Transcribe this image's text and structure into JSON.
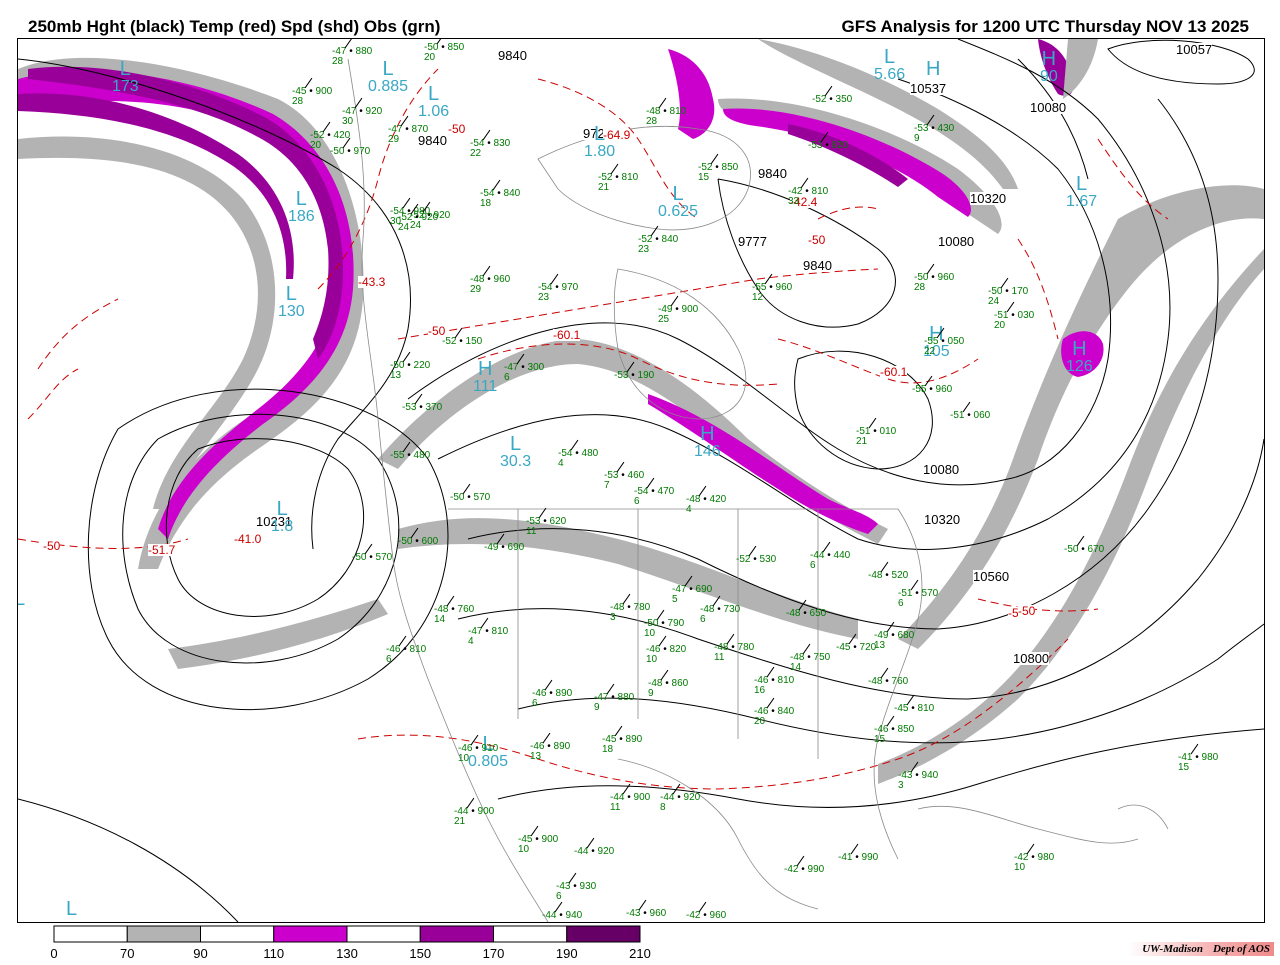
{
  "header": {
    "title_left": "250mb Hght (black) Temp (red) Spd (shd) Obs (grn)",
    "title_right": "GFS Analysis for 1200 UTC Thursday  NOV 13 2025"
  },
  "colors": {
    "height_contour": "#000000",
    "temperature_contour": "#cc0000",
    "obs_text": "#007a00",
    "center_label": "#3aa8c4",
    "coastline": "#8a8a8a"
  },
  "speed_legend": {
    "ticks": [
      "0",
      "70",
      "90",
      "110",
      "130",
      "150",
      "170",
      "190",
      "210"
    ],
    "bins": [
      {
        "from": "0",
        "to": "70",
        "color": "#ffffff"
      },
      {
        "from": "70",
        "to": "90",
        "color": "#b3b3b3"
      },
      {
        "from": "90",
        "to": "110",
        "color": "#ffffff"
      },
      {
        "from": "110",
        "to": "130",
        "color": "#cc00cc"
      },
      {
        "from": "130",
        "to": "150",
        "color": "#ffffff"
      },
      {
        "from": "150",
        "to": "170",
        "color": "#990099"
      },
      {
        "from": "170",
        "to": "190",
        "color": "#ffffff"
      },
      {
        "from": "190",
        "to": "210",
        "color": "#660066"
      }
    ]
  },
  "height_labels": [
    "9840",
    "9840",
    "9840",
    "9840",
    "9728",
    "9777",
    "10057",
    "10537",
    "10080",
    "10080",
    "10080",
    "10320",
    "10320",
    "10560",
    "10800",
    "10231"
  ],
  "temperature_labels": [
    "-50",
    "-50",
    "-50",
    "-50",
    "-50",
    "-50",
    "-41.0",
    "-51.7",
    "-43.3",
    "-60.1",
    "-60.1",
    "-64.9",
    "-42.4"
  ],
  "pressure_centers": [
    {
      "type": "L",
      "value": "173"
    },
    {
      "type": "L",
      "value": "0.885"
    },
    {
      "type": "L",
      "value": "1.06"
    },
    {
      "type": "L",
      "value": "1.80"
    },
    {
      "type": "L",
      "value": "0.625"
    },
    {
      "type": "L",
      "value": "5.66"
    },
    {
      "type": "H",
      "value": ""
    },
    {
      "type": "L",
      "value": "1.67"
    },
    {
      "type": "H",
      "value": "90"
    },
    {
      "type": "L",
      "value": "186"
    },
    {
      "type": "L",
      "value": "130"
    },
    {
      "type": "H",
      "value": "111"
    },
    {
      "type": "L",
      "value": "30.3"
    },
    {
      "type": "H",
      "value": "105"
    },
    {
      "type": "H",
      "value": "126"
    },
    {
      "type": "L",
      "value": "1.8"
    },
    {
      "type": "H",
      "value": "146"
    },
    {
      "type": "L",
      "value": "0.805"
    },
    {
      "type": "L",
      "value": ""
    },
    {
      "type": "L",
      "value": ""
    }
  ],
  "observations": [
    {
      "t": "-47",
      "h": "880",
      "d": "28"
    },
    {
      "t": "-50",
      "h": "850",
      "d": "20"
    },
    {
      "t": "-45",
      "h": "900",
      "d": "28"
    },
    {
      "t": "-47",
      "h": "920",
      "d": "30"
    },
    {
      "t": "-47",
      "h": "870",
      "d": "29"
    },
    {
      "t": "-54",
      "h": "830",
      "d": "22"
    },
    {
      "t": "-54",
      "h": "840",
      "d": "18"
    },
    {
      "t": "-54",
      "h": "980",
      "d": "30"
    },
    {
      "t": "-52",
      "h": "920",
      "d": "24"
    },
    {
      "t": "-52",
      "h": "810",
      "d": "21"
    },
    {
      "t": "-52",
      "h": "840",
      "d": "23"
    },
    {
      "t": "-48",
      "h": "960",
      "d": "29"
    },
    {
      "t": "-54",
      "h": "970",
      "d": "23"
    },
    {
      "t": "-49",
      "h": "900",
      "d": "25"
    },
    {
      "t": "-55",
      "h": "960",
      "d": "12"
    },
    {
      "t": "-50",
      "h": "960",
      "d": "28"
    },
    {
      "t": "-52",
      "h": "150",
      "d": ""
    },
    {
      "t": "-47",
      "h": "300",
      "d": "6"
    },
    {
      "t": "-50",
      "h": "220",
      "d": "13"
    },
    {
      "t": "-53",
      "h": "190",
      "d": ""
    },
    {
      "t": "-51",
      "h": "030",
      "d": "20"
    },
    {
      "t": "-55",
      "h": "050",
      "d": "22"
    },
    {
      "t": "-53",
      "h": "370",
      "d": ""
    },
    {
      "t": "-55",
      "h": "960",
      "d": ""
    },
    {
      "t": "-51",
      "h": "060",
      "d": ""
    },
    {
      "t": "-51",
      "h": "010",
      "d": "21"
    },
    {
      "t": "-55",
      "h": "480",
      "d": ""
    },
    {
      "t": "-54",
      "h": "480",
      "d": "4"
    },
    {
      "t": "-53",
      "h": "460",
      "d": "7"
    },
    {
      "t": "-54",
      "h": "470",
      "d": "6"
    },
    {
      "t": "-50",
      "h": "570",
      "d": ""
    },
    {
      "t": "-48",
      "h": "420",
      "d": "4"
    },
    {
      "t": "-53",
      "h": "620",
      "d": "11"
    },
    {
      "t": "-50",
      "h": "600",
      "d": ""
    },
    {
      "t": "-49",
      "h": "690",
      "d": ""
    },
    {
      "t": "-50",
      "h": "570",
      "d": ""
    },
    {
      "t": "-52",
      "h": "530",
      "d": ""
    },
    {
      "t": "-44",
      "h": "440",
      "d": "6"
    },
    {
      "t": "-48",
      "h": "520",
      "d": ""
    },
    {
      "t": "-51",
      "h": "570",
      "d": "6"
    },
    {
      "t": "-50",
      "h": "670",
      "d": ""
    },
    {
      "t": "-48",
      "h": "650",
      "d": ""
    },
    {
      "t": "-48",
      "h": "760",
      "d": "14"
    },
    {
      "t": "-48",
      "h": "780",
      "d": "3"
    },
    {
      "t": "-47",
      "h": "810",
      "d": "4"
    },
    {
      "t": "-50",
      "h": "790",
      "d": "10"
    },
    {
      "t": "-48",
      "h": "730",
      "d": "6"
    },
    {
      "t": "-47",
      "h": "690",
      "d": "5"
    },
    {
      "t": "-46",
      "h": "820",
      "d": "10"
    },
    {
      "t": "-48",
      "h": "780",
      "d": "11"
    },
    {
      "t": "-48",
      "h": "750",
      "d": "14"
    },
    {
      "t": "-45",
      "h": "720",
      "d": ""
    },
    {
      "t": "-49",
      "h": "680",
      "d": "13"
    },
    {
      "t": "-46",
      "h": "810",
      "d": "6"
    },
    {
      "t": "-46",
      "h": "890",
      "d": "6"
    },
    {
      "t": "-47",
      "h": "880",
      "d": "9"
    },
    {
      "t": "-48",
      "h": "860",
      "d": "9"
    },
    {
      "t": "-46",
      "h": "810",
      "d": "16"
    },
    {
      "t": "-46",
      "h": "840",
      "d": "20"
    },
    {
      "t": "-48",
      "h": "760",
      "d": ""
    },
    {
      "t": "-45",
      "h": "810",
      "d": ""
    },
    {
      "t": "-46",
      "h": "850",
      "d": "15"
    },
    {
      "t": "-46",
      "h": "910",
      "d": "10"
    },
    {
      "t": "-46",
      "h": "890",
      "d": "13"
    },
    {
      "t": "-45",
      "h": "890",
      "d": "18"
    },
    {
      "t": "-43",
      "h": "940",
      "d": "3"
    },
    {
      "t": "-41",
      "h": "980",
      "d": "15"
    },
    {
      "t": "-44",
      "h": "900",
      "d": "21"
    },
    {
      "t": "-44",
      "h": "900",
      "d": "11"
    },
    {
      "t": "-44",
      "h": "920",
      "d": "8"
    },
    {
      "t": "-45",
      "h": "900",
      "d": "10"
    },
    {
      "t": "-44",
      "h": "920",
      "d": ""
    },
    {
      "t": "-42",
      "h": "990",
      "d": ""
    },
    {
      "t": "-41",
      "h": "990",
      "d": ""
    },
    {
      "t": "-42",
      "h": "980",
      "d": "10"
    },
    {
      "t": "-43",
      "h": "930",
      "d": "6"
    },
    {
      "t": "-44",
      "h": "940",
      "d": ""
    },
    {
      "t": "-43",
      "h": "960",
      "d": ""
    },
    {
      "t": "-42",
      "h": "960",
      "d": ""
    },
    {
      "t": "-42",
      "h": "810",
      "d": "33"
    },
    {
      "t": "-52",
      "h": "350",
      "d": ""
    },
    {
      "t": "-53",
      "h": "430",
      "d": "9"
    },
    {
      "t": "-53",
      "h": "820",
      "d": ""
    },
    {
      "t": "-50",
      "h": "170",
      "d": "24"
    },
    {
      "t": "-48",
      "h": "810",
      "d": "28"
    },
    {
      "t": "-52",
      "h": "850",
      "d": "15"
    },
    {
      "t": "-52",
      "h": "420",
      "d": "20"
    },
    {
      "t": "-50",
      "h": "970",
      "d": ""
    },
    {
      "t": "-52",
      "h": "920",
      "d": "24"
    }
  ],
  "credit": {
    "institution": "UW-Madison",
    "dept": "Dept of AOS"
  }
}
